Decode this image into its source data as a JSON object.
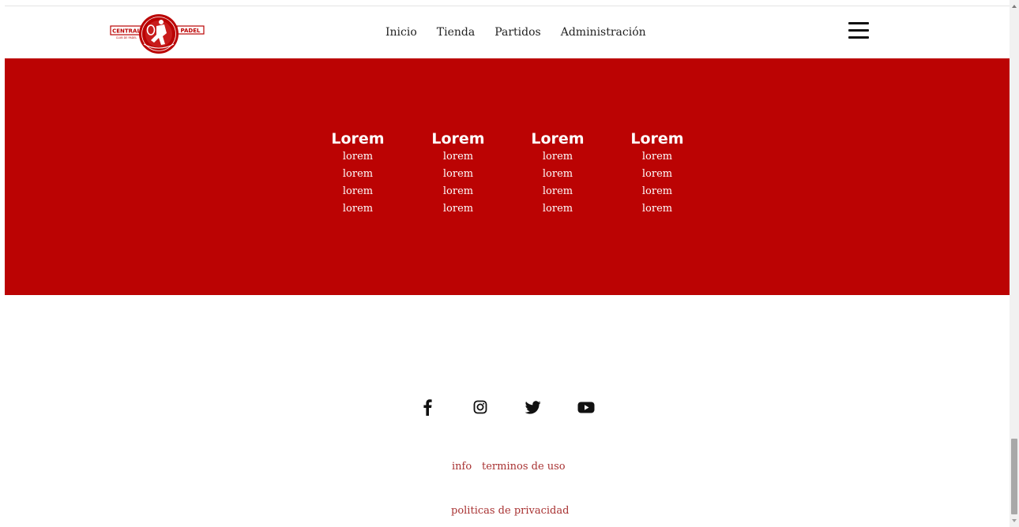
{
  "colors": {
    "brand_red": "#bb0303",
    "link_red": "#a83232",
    "text_dark": "#222222"
  },
  "header": {
    "logo": {
      "left_text": "CENTRAL",
      "right_text": "PADEL",
      "sub_text": "CLUB DE PADEL"
    },
    "nav": [
      {
        "label": "Inicio"
      },
      {
        "label": "Tienda"
      },
      {
        "label": "Partidos"
      },
      {
        "label": "Administración"
      }
    ],
    "menu_icon": "hamburger-menu-icon"
  },
  "band": {
    "columns": [
      {
        "title": "Lorem",
        "items": [
          "lorem",
          "lorem",
          "lorem",
          "lorem"
        ]
      },
      {
        "title": "Lorem",
        "items": [
          "lorem",
          "lorem",
          "lorem",
          "lorem"
        ]
      },
      {
        "title": "Lorem",
        "items": [
          "lorem",
          "lorem",
          "lorem",
          "lorem"
        ]
      },
      {
        "title": "Lorem",
        "items": [
          "lorem",
          "lorem",
          "lorem",
          "lorem"
        ]
      }
    ]
  },
  "footer": {
    "social_icons": [
      "facebook-icon",
      "instagram-icon",
      "twitter-icon",
      "youtube-icon"
    ],
    "links": {
      "info": "info",
      "terms": "terminos de uso",
      "privacy": "politicas de privacidad"
    }
  }
}
